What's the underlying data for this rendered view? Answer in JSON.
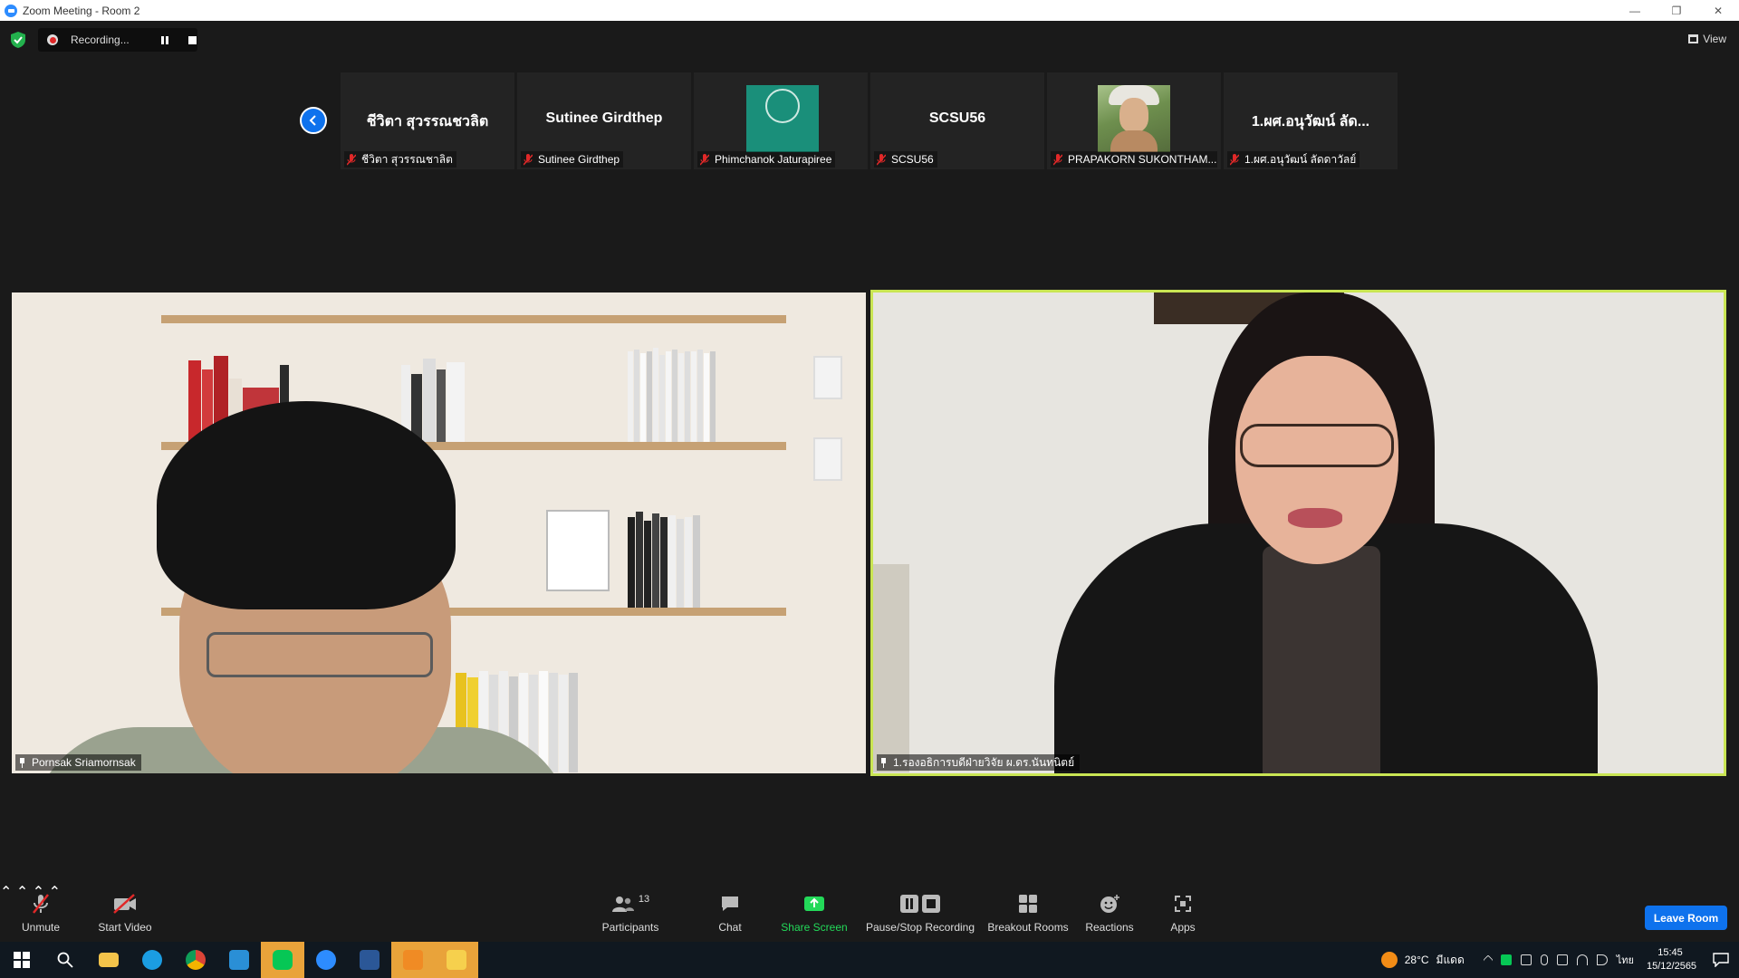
{
  "window": {
    "title": "Zoom Meeting - Room 2"
  },
  "recording": {
    "status": "Recording..."
  },
  "view": {
    "label": "View"
  },
  "thumbnails": [
    {
      "display": "ชีวิตา สุวรรณชวลิต",
      "name": "ชีวิตา สุวรรณชาลิต",
      "type": "text"
    },
    {
      "display": "Sutinee Girdthep",
      "name": "Sutinee Girdthep",
      "type": "text"
    },
    {
      "display": "",
      "name": "Phimchanok Jaturapiree",
      "type": "logo"
    },
    {
      "display": "SCSU56",
      "name": "SCSU56",
      "type": "text"
    },
    {
      "display": "",
      "name": "PRAPAKORN SUKONTHAM...",
      "type": "photo"
    },
    {
      "display": "1.ผศ.อนุวัฒน์ ลัด...",
      "name": "1.ผศ.อนุวัฒน์ ลัดดาวัลย์",
      "type": "text"
    }
  ],
  "videos": {
    "left": {
      "name": "Pornsak Sriamornsak"
    },
    "right": {
      "name": "1.รองอธิการบดีฝ่ายวิจัย ผ.ดร.นันทนิตย์"
    }
  },
  "toolbar": {
    "unmute": "Unmute",
    "start_video": "Start Video",
    "participants": "Participants",
    "participants_count": "13",
    "chat": "Chat",
    "share_screen": "Share Screen",
    "pause_stop_recording": "Pause/Stop Recording",
    "breakout_rooms": "Breakout Rooms",
    "reactions": "Reactions",
    "apps": "Apps",
    "leave_room": "Leave Room"
  },
  "taskbar": {
    "weather_temp": "28°C",
    "weather_desc": "มีแดด",
    "language": "ไทย",
    "time": "15:45",
    "date": "15/12/2565"
  },
  "colors": {
    "accent_blue": "#0e72ed",
    "share_green": "#23d959",
    "active_speaker_border": "#c9e553",
    "mute_red": "#e02828"
  }
}
